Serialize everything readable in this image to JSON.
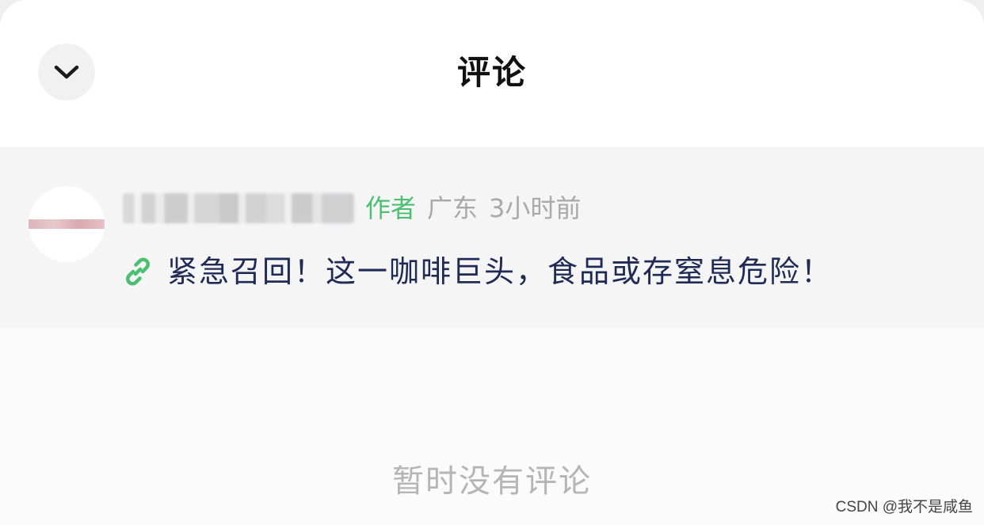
{
  "header": {
    "title": "评论",
    "collapse_icon": "chevron-down-icon"
  },
  "post": {
    "avatar": "avatar",
    "author_tag": "作者",
    "location": "广东",
    "time": "3小时前",
    "link_icon": "link-icon",
    "link_icon_color": "#4cbf72",
    "content": "紧急召回！这一咖啡巨头，食品或存窒息危险！"
  },
  "comments": {
    "empty_text": "暂时没有评论"
  },
  "watermark": "CSDN @我不是咸鱼",
  "colors": {
    "accent_green": "#4cbf72",
    "content_text": "#1f2b55",
    "muted_text": "#a9a9a9"
  }
}
